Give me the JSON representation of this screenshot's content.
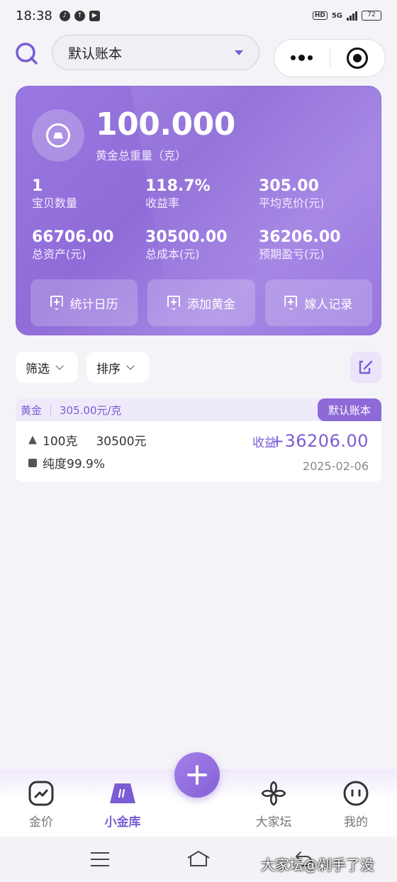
{
  "status_bar": {
    "time": "18:38",
    "network": "5G",
    "hd": "HD",
    "battery": "72"
  },
  "header": {
    "ledger_name": "默认账本",
    "icons": [
      "search-icon",
      "more-icon",
      "target-icon"
    ]
  },
  "summary": {
    "total_weight": "100.000",
    "total_weight_label": "黄金总重量（克）",
    "stats": [
      {
        "value": "1",
        "label": "宝贝数量"
      },
      {
        "value": "118.7%",
        "label": "收益率"
      },
      {
        "value": "305.00",
        "label": "平均克价(元)"
      },
      {
        "value": "66706.00",
        "label": "总资产(元)"
      },
      {
        "value": "30500.00",
        "label": "总成本(元)"
      },
      {
        "value": "36206.00",
        "label": "预期盈亏(元)"
      }
    ],
    "actions": [
      "统计日历",
      "添加黄金",
      "嫁人记录"
    ]
  },
  "filters": {
    "filter_label": "筛选",
    "sort_label": "排序"
  },
  "holding": {
    "type": "黄金",
    "price_per_gram": "305.00元/克",
    "ledger_tag": "默认账本",
    "weight": "100克",
    "cost": "30500元",
    "purity": "纯度99.9%",
    "profit_label": "收益",
    "profit_value": "+36206.00",
    "date": "2025-02-06"
  },
  "tabbar": {
    "tabs": [
      "金价",
      "小金库",
      "大家坛",
      "我的"
    ],
    "active": "小金库"
  },
  "watermark": "大家坛@剁手了没",
  "colors": {
    "accent": "#7b5cd4",
    "card": "#9a78e0",
    "background": "#f3f3f8"
  }
}
